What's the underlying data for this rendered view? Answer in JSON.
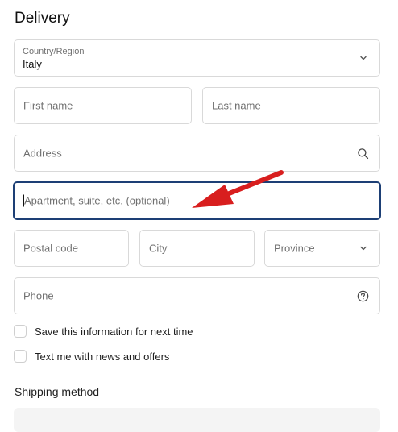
{
  "delivery": {
    "title": "Delivery",
    "country": {
      "label": "Country/Region",
      "value": "Italy",
      "icon": "chevron-down-icon"
    },
    "first_name": {
      "placeholder": "First name"
    },
    "last_name": {
      "placeholder": "Last name"
    },
    "address": {
      "placeholder": "Address",
      "icon": "search-icon"
    },
    "apartment": {
      "placeholder": "Apartment, suite, etc. (optional)",
      "focused": true
    },
    "postal_code": {
      "placeholder": "Postal code"
    },
    "city": {
      "placeholder": "City"
    },
    "province": {
      "placeholder": "Province",
      "icon": "chevron-down-icon"
    },
    "phone": {
      "placeholder": "Phone",
      "icon": "help-icon"
    },
    "checkboxes": [
      {
        "label": "Save this information for next time",
        "checked": false
      },
      {
        "label": "Text me with news and offers",
        "checked": false
      }
    ]
  },
  "shipping": {
    "title": "Shipping method"
  },
  "colors": {
    "focus_border": "#1d3f75",
    "annotation_arrow": "#d81e1e"
  }
}
